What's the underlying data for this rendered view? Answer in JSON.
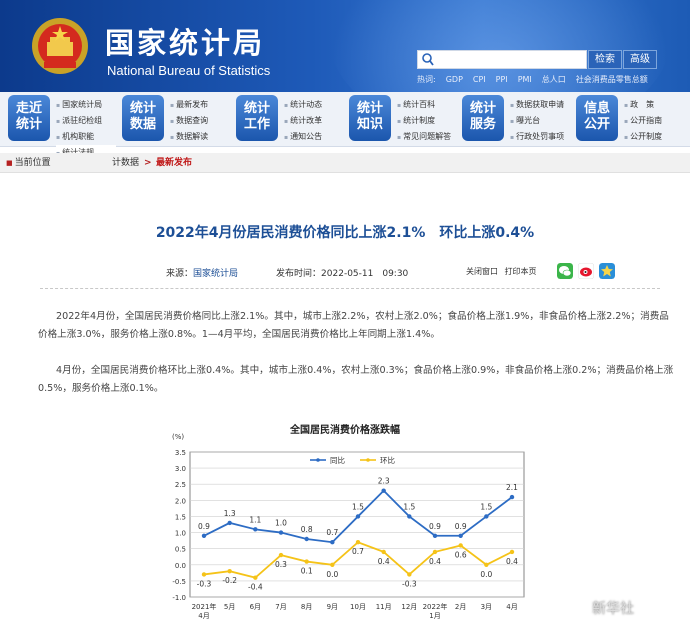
{
  "header": {
    "title": "国家统计局",
    "subtitle": "National Bureau of Statistics",
    "search_button": "检索",
    "advanced_button": "高级",
    "hot_label": "热词:",
    "hot_words": [
      "GDP",
      "CPI",
      "PPI",
      "PMI",
      "总人口",
      "社会消费品零售总额"
    ]
  },
  "nav": [
    {
      "label": [
        "走近",
        "统计"
      ],
      "links": [
        "国家统计局",
        "派驻纪检组",
        "机构职能",
        "统计法规"
      ]
    },
    {
      "label": [
        "统计",
        "数据"
      ],
      "links": [
        "最新发布",
        "数据查询",
        "数据解读"
      ]
    },
    {
      "label": [
        "统计",
        "工作"
      ],
      "links": [
        "统计动态",
        "统计改革",
        "通知公告"
      ]
    },
    {
      "label": [
        "统计",
        "知识"
      ],
      "links": [
        "统计百科",
        "统计制度",
        "常见问题解答"
      ]
    },
    {
      "label": [
        "统计",
        "服务"
      ],
      "links": [
        "数据获取申请",
        "曝光台",
        "行政处罚事项"
      ]
    },
    {
      "label": [
        "信息",
        "公开"
      ],
      "links": [
        "政　策",
        "公开指南",
        "公开制度"
      ]
    }
  ],
  "breadcrumb": {
    "home": "当前位置",
    "mid": "计数据",
    "arrow": ">",
    "current": "最新发布"
  },
  "article": {
    "title": "2022年4月份居民消费价格同比上涨2.1%　环比上涨0.4%",
    "source_label": "来源：",
    "source": "国家统计局",
    "time_label": "发布时间：",
    "time": "2022-05-11　09:30",
    "close_window": "关闭窗口",
    "print": "打印本页",
    "para1": "2022年4月份，全国居民消费价格同比上涨2.1%。其中，城市上涨2.2%，农村上涨2.0%；食品价格上涨1.9%，非食品价格上涨2.2%；消费品价格上涨3.0%，服务价格上涨0.8%。1—4月平均，全国居民消费价格比上年同期上涨1.4%。",
    "para2": "4月份，全国居民消费价格环比上涨0.4%。其中，城市上涨0.4%，农村上涨0.3%；食品价格上涨0.9%，非食品价格上涨0.2%；消费品价格上涨0.5%，服务价格上涨0.1%。"
  },
  "chart_data": {
    "type": "line",
    "title": "全国居民消费价格涨跌幅",
    "ylabel": "(%)",
    "ylim": [
      -1.0,
      3.5
    ],
    "yticks": [
      "-1.0",
      "-0.5",
      "0.0",
      "0.5",
      "1.0",
      "1.5",
      "2.0",
      "2.5",
      "3.0",
      "3.5"
    ],
    "grid": true,
    "legend": "top-center",
    "categories": [
      "2021年\n4月",
      "5月",
      "6月",
      "7月",
      "8月",
      "9月",
      "10月",
      "11月",
      "12月",
      "2022年\n1月",
      "2月",
      "3月",
      "4月"
    ],
    "series": [
      {
        "name": "同比",
        "color": "#2d6cc4",
        "values": [
          0.9,
          1.3,
          1.1,
          1.0,
          0.8,
          0.7,
          1.5,
          2.3,
          1.5,
          0.9,
          0.9,
          1.5,
          2.1
        ]
      },
      {
        "name": "环比",
        "color": "#f5c318",
        "values": [
          -0.3,
          -0.2,
          -0.4,
          0.3,
          0.1,
          0.0,
          0.7,
          0.4,
          -0.3,
          0.4,
          0.6,
          0.0,
          0.4
        ]
      }
    ]
  },
  "watermark": "新华社"
}
